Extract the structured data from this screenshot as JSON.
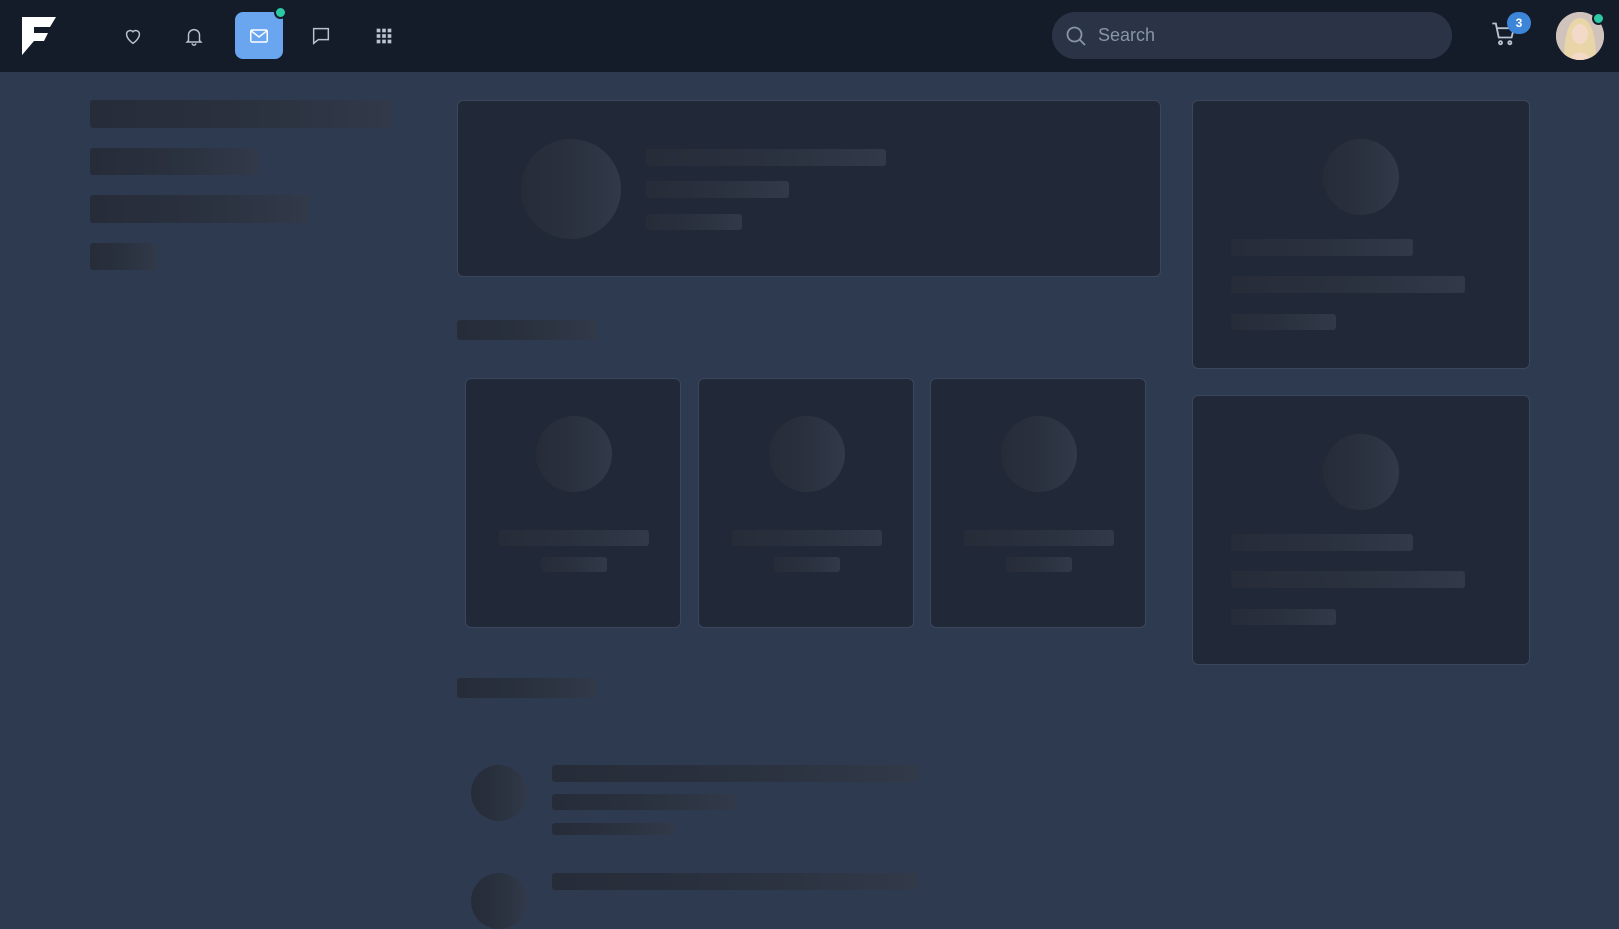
{
  "topbar": {
    "logo_icon": "brand-f-logo",
    "nav": [
      {
        "name": "favorites",
        "icon": "heart-icon",
        "active": false
      },
      {
        "name": "notifications",
        "icon": "bell-icon",
        "active": false
      },
      {
        "name": "mail",
        "icon": "mail-icon",
        "active": true,
        "has_dot": true
      },
      {
        "name": "messages",
        "icon": "chat-icon",
        "active": false
      },
      {
        "name": "apps",
        "icon": "grid-icon",
        "active": false
      }
    ],
    "search_placeholder": "Search",
    "cart_count": "3",
    "avatar_online": true
  },
  "colors": {
    "topbar_bg": "#141c29",
    "page_bg": "#2e3a50",
    "active_nav": "#6aa6f0",
    "status_dot": "#2cc9a6",
    "badge": "#3d85d8"
  },
  "state": "loading-skeleton"
}
